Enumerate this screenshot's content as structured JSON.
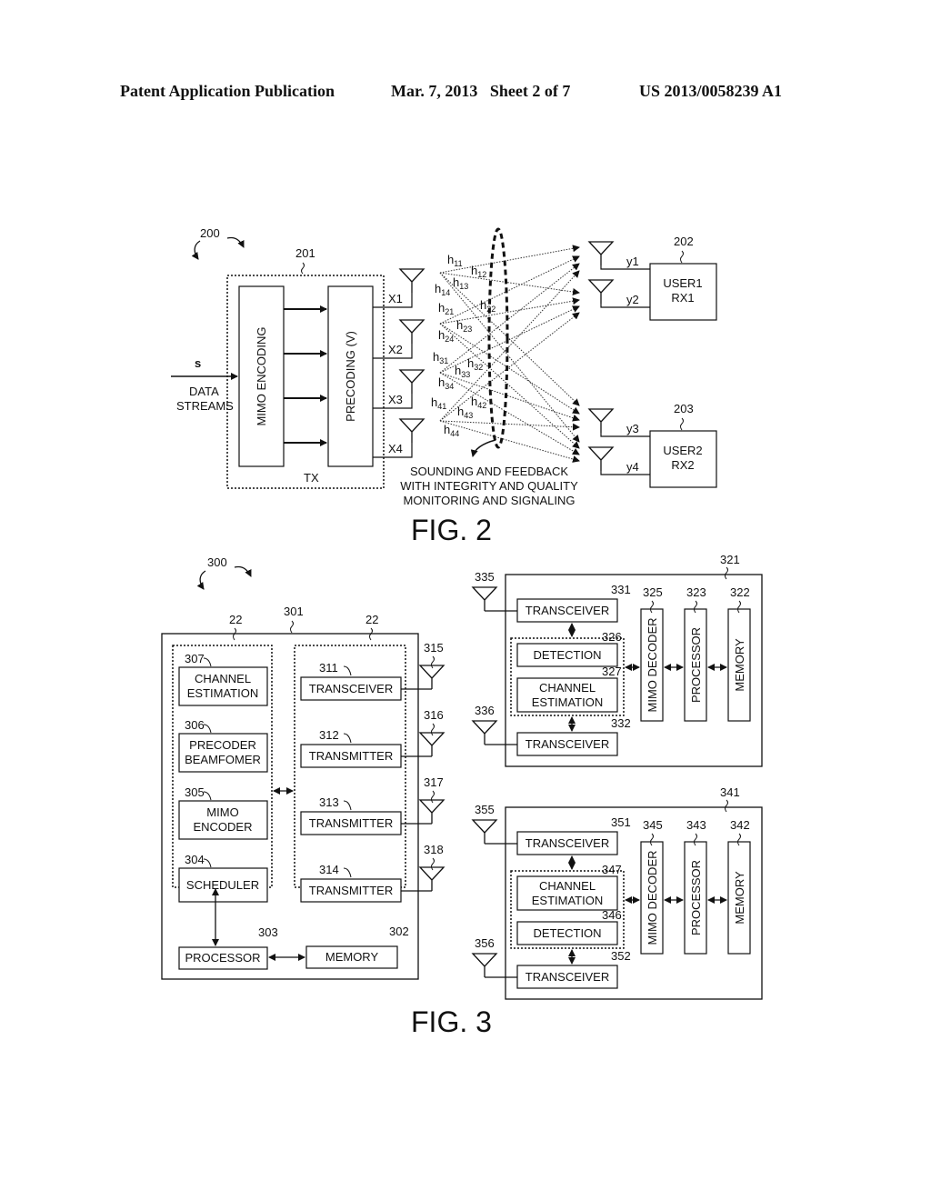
{
  "header": {
    "publication": "Patent Application Publication",
    "date_sheet": "Mar. 7, 2013   Sheet 2 of 7",
    "number": "US 2013/0058239 A1"
  },
  "fig2": {
    "caption": "FIG. 2",
    "ref_system": "200",
    "ref_tx": "201",
    "tx_label": "TX",
    "input_symbol": "s",
    "input_label_1": "DATA",
    "input_label_2": "STREAMS",
    "mimo_encoding": "MIMO ENCODING",
    "precoding": "PRECODING (V)",
    "tx_antennas": [
      "X1",
      "X2",
      "X3",
      "X4"
    ],
    "channels": [
      {
        "base": "h",
        "sub": "11"
      },
      {
        "base": "h",
        "sub": "12"
      },
      {
        "base": "h",
        "sub": "13"
      },
      {
        "base": "h",
        "sub": "14"
      },
      {
        "base": "h",
        "sub": "21"
      },
      {
        "base": "h",
        "sub": "22"
      },
      {
        "base": "h",
        "sub": "23"
      },
      {
        "base": "h",
        "sub": "24"
      },
      {
        "base": "h",
        "sub": "31"
      },
      {
        "base": "h",
        "sub": "32"
      },
      {
        "base": "h",
        "sub": "33"
      },
      {
        "base": "h",
        "sub": "34"
      },
      {
        "base": "h",
        "sub": "41"
      },
      {
        "base": "h",
        "sub": "42"
      },
      {
        "base": "h",
        "sub": "43"
      },
      {
        "base": "h",
        "sub": "44"
      }
    ],
    "feedback_note": [
      "SOUNDING AND FEEDBACK",
      "WITH INTEGRITY AND QUALITY",
      "MONITORING AND SIGNALING"
    ],
    "users": [
      {
        "ref": "202",
        "line1": "USER1",
        "line2": "RX1",
        "outputs": [
          "y1",
          "y2"
        ]
      },
      {
        "ref": "203",
        "line1": "USER2",
        "line2": "RX2",
        "outputs": [
          "y3",
          "y4"
        ]
      }
    ]
  },
  "fig3": {
    "caption": "FIG. 3",
    "ref_system": "300",
    "base_station": {
      "ref": "301",
      "group_refs": [
        "22",
        "22"
      ],
      "left_blocks": [
        {
          "ref": "307",
          "line1": "CHANNEL",
          "line2": "ESTIMATION"
        },
        {
          "ref": "306",
          "line1": "PRECODER",
          "line2": "BEAMFOMER"
        },
        {
          "ref": "305",
          "line1": "MIMO",
          "line2": "ENCODER"
        },
        {
          "ref": "304",
          "line1": "SCHEDULER",
          "line2": ""
        }
      ],
      "right_blocks": [
        {
          "ref": "311",
          "label": "TRANSCEIVER",
          "antenna": "315"
        },
        {
          "ref": "312",
          "label": "TRANSMITTER",
          "antenna": "316"
        },
        {
          "ref": "313",
          "label": "TRANSMITTER",
          "antenna": "317"
        },
        {
          "ref": "314",
          "label": "TRANSMITTER",
          "antenna": "318"
        }
      ],
      "processor": {
        "ref": "303",
        "label": "PROCESSOR"
      },
      "memory": {
        "ref": "302",
        "label": "MEMORY"
      }
    },
    "receivers": [
      {
        "ref": "321",
        "transceiver_top": {
          "ref": "331",
          "label": "TRANSCEIVER",
          "antenna": "335"
        },
        "transceiver_bottom": {
          "ref": "332",
          "label": "TRANSCEIVER",
          "antenna": "336"
        },
        "inner_top": {
          "ref": "326",
          "line1": "DETECTION",
          "line2": ""
        },
        "inner_bottom": {
          "ref": "327",
          "line1": "CHANNEL",
          "line2": "ESTIMATION"
        },
        "decoder": {
          "ref": "325",
          "label": "MIMO DECODER"
        },
        "processor": {
          "ref": "323",
          "label": "PROCESSOR"
        },
        "memory": {
          "ref": "322",
          "label": "MEMORY"
        }
      },
      {
        "ref": "341",
        "transceiver_top": {
          "ref": "351",
          "label": "TRANSCEIVER",
          "antenna": "355"
        },
        "transceiver_bottom": {
          "ref": "352",
          "label": "TRANSCEIVER",
          "antenna": "356"
        },
        "inner_top": {
          "ref": "347",
          "line1": "CHANNEL",
          "line2": "ESTIMATION"
        },
        "inner_bottom": {
          "ref": "346",
          "line1": "DETECTION",
          "line2": ""
        },
        "decoder": {
          "ref": "345",
          "label": "MIMO DECODER"
        },
        "processor": {
          "ref": "343",
          "label": "PROCESSOR"
        },
        "memory": {
          "ref": "342",
          "label": "MEMORY"
        }
      }
    ]
  }
}
